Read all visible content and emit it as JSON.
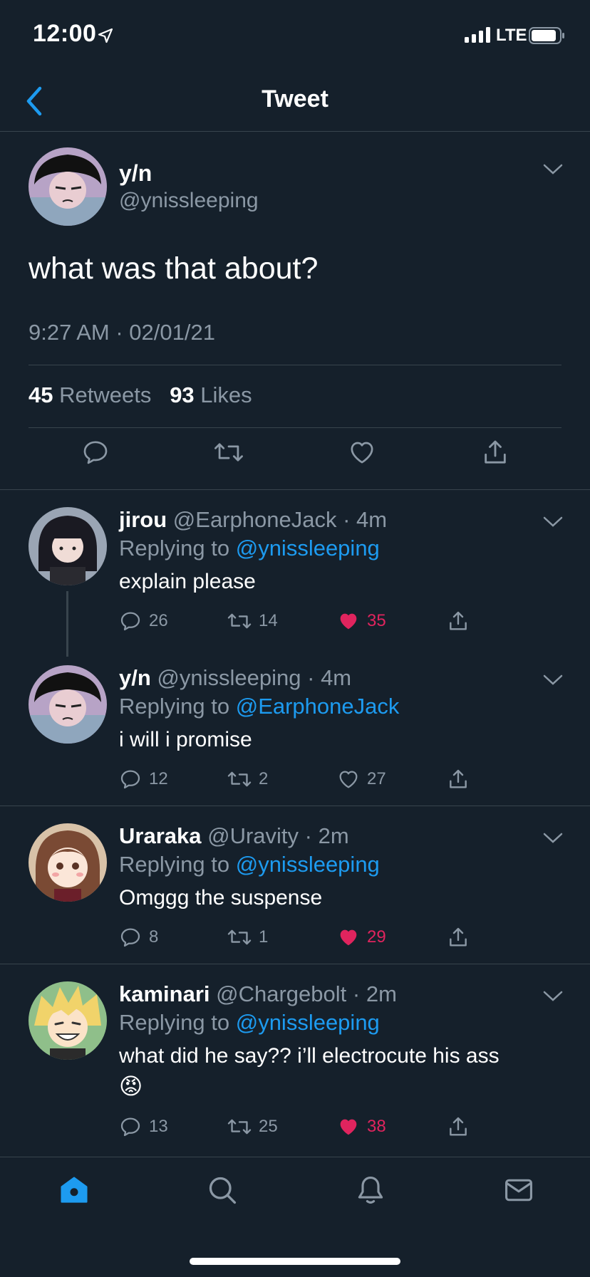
{
  "status_bar": {
    "time": "12:00",
    "network": "LTE"
  },
  "nav": {
    "title": "Tweet"
  },
  "main_tweet": {
    "name": "y/n",
    "handle": "@ynissleeping",
    "text": "what was that about?",
    "timestamp": "9:27 AM · 02/01/21",
    "retweets_count": "45",
    "retweets_label": "Retweets",
    "likes_count": "93",
    "likes_label": "Likes"
  },
  "replies": [
    {
      "name": "jirou",
      "handle": "@EarphoneJack",
      "time": "4m",
      "replying_label": "Replying to",
      "replying_to": "@ynissleeping",
      "text": "explain please",
      "comments": "26",
      "retweets": "14",
      "likes": "35",
      "liked": true
    },
    {
      "name": "y/n",
      "handle": "@ynissleeping",
      "time": "4m",
      "replying_label": "Replying to",
      "replying_to": "@EarphoneJack",
      "text": "i will i promise",
      "comments": "12",
      "retweets": "2",
      "likes": "27",
      "liked": false
    },
    {
      "name": "Uraraka",
      "handle": "@Uravity",
      "time": "2m",
      "replying_label": "Replying to",
      "replying_to": "@ynissleeping",
      "text": "Omggg the suspense",
      "comments": "8",
      "retweets": "1",
      "likes": "29",
      "liked": true
    },
    {
      "name": "kaminari",
      "handle": "@Chargebolt",
      "time": "2m",
      "replying_label": "Replying to",
      "replying_to": "@ynissleeping",
      "text": "what did he say?? i’ll electrocute his ass",
      "emoji": "😡",
      "comments": "13",
      "retweets": "25",
      "likes": "38",
      "liked": true
    }
  ],
  "tabs": [
    "home-icon",
    "search-icon",
    "bell-icon",
    "mail-icon"
  ],
  "colors": {
    "background": "#15202b",
    "accent": "#1d9bf0",
    "like": "#e0245e",
    "muted": "#8b98a5",
    "divider": "#38444d"
  }
}
